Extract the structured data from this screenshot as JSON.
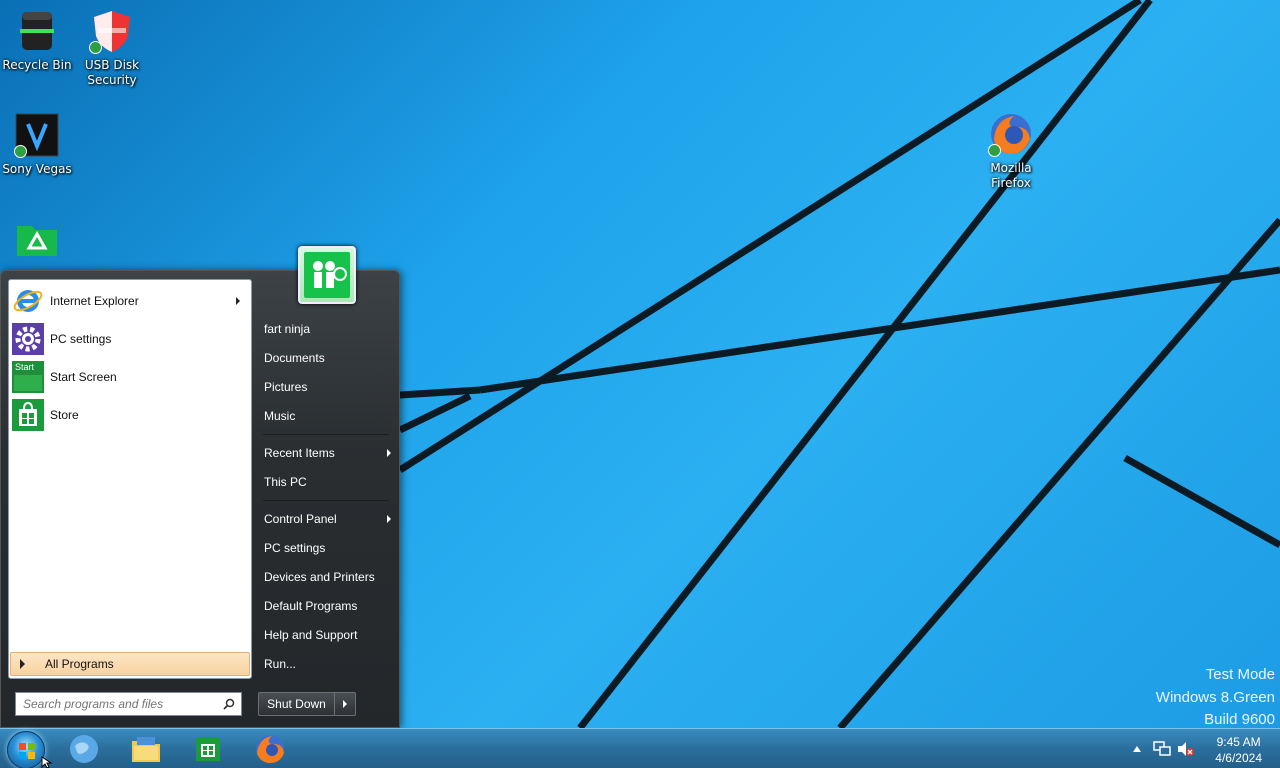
{
  "desktop": {
    "icons": [
      {
        "label": "Recycle Bin",
        "icon": "recycle-bin-icon"
      },
      {
        "label": "USB Disk Security",
        "icon": "shield-icon"
      },
      {
        "label": "Sony Vegas",
        "icon": "sony-vegas-icon"
      },
      {
        "label": "",
        "icon": "green-folder-icon"
      },
      {
        "label": "Mozilla Firefox",
        "icon": "firefox-icon"
      }
    ],
    "watermark": {
      "line1": "Test Mode",
      "line2": "Windows 8.Green",
      "line3": "Build 9600"
    }
  },
  "start_menu": {
    "programs": [
      {
        "label": "Internet Explorer",
        "icon": "internet-explorer-icon",
        "has_submenu": true
      },
      {
        "label": "PC settings",
        "icon": "gear-icon",
        "has_submenu": false
      },
      {
        "label": "Start Screen",
        "icon": "start-screen-icon",
        "icon_text": "Start",
        "has_submenu": false
      },
      {
        "label": "Store",
        "icon": "store-icon",
        "has_submenu": false
      }
    ],
    "all_programs": "All Programs",
    "search_placeholder": "Search programs and files",
    "right": {
      "user": "fart ninja",
      "documents": "Documents",
      "pictures": "Pictures",
      "music": "Music",
      "recent_items": "Recent Items",
      "this_pc": "This PC",
      "control_panel": "Control Panel",
      "pc_settings": "PC settings",
      "devices_printers": "Devices and Printers",
      "default_programs": "Default Programs",
      "help_support": "Help and Support",
      "run": "Run..."
    },
    "shutdown_label": "Shut Down"
  },
  "taskbar": {
    "pinned": [
      "internet-globe-icon",
      "file-explorer-icon",
      "store-icon",
      "firefox-icon"
    ],
    "clock_time": "9:45 AM",
    "clock_date": "4/6/2024"
  },
  "colors": {
    "desktop_blue": "#1a9be6",
    "start_menu_bg": "#2a2e31",
    "all_programs_highlight": "#f8d2a0",
    "taskbar": "#2b6f9e"
  }
}
